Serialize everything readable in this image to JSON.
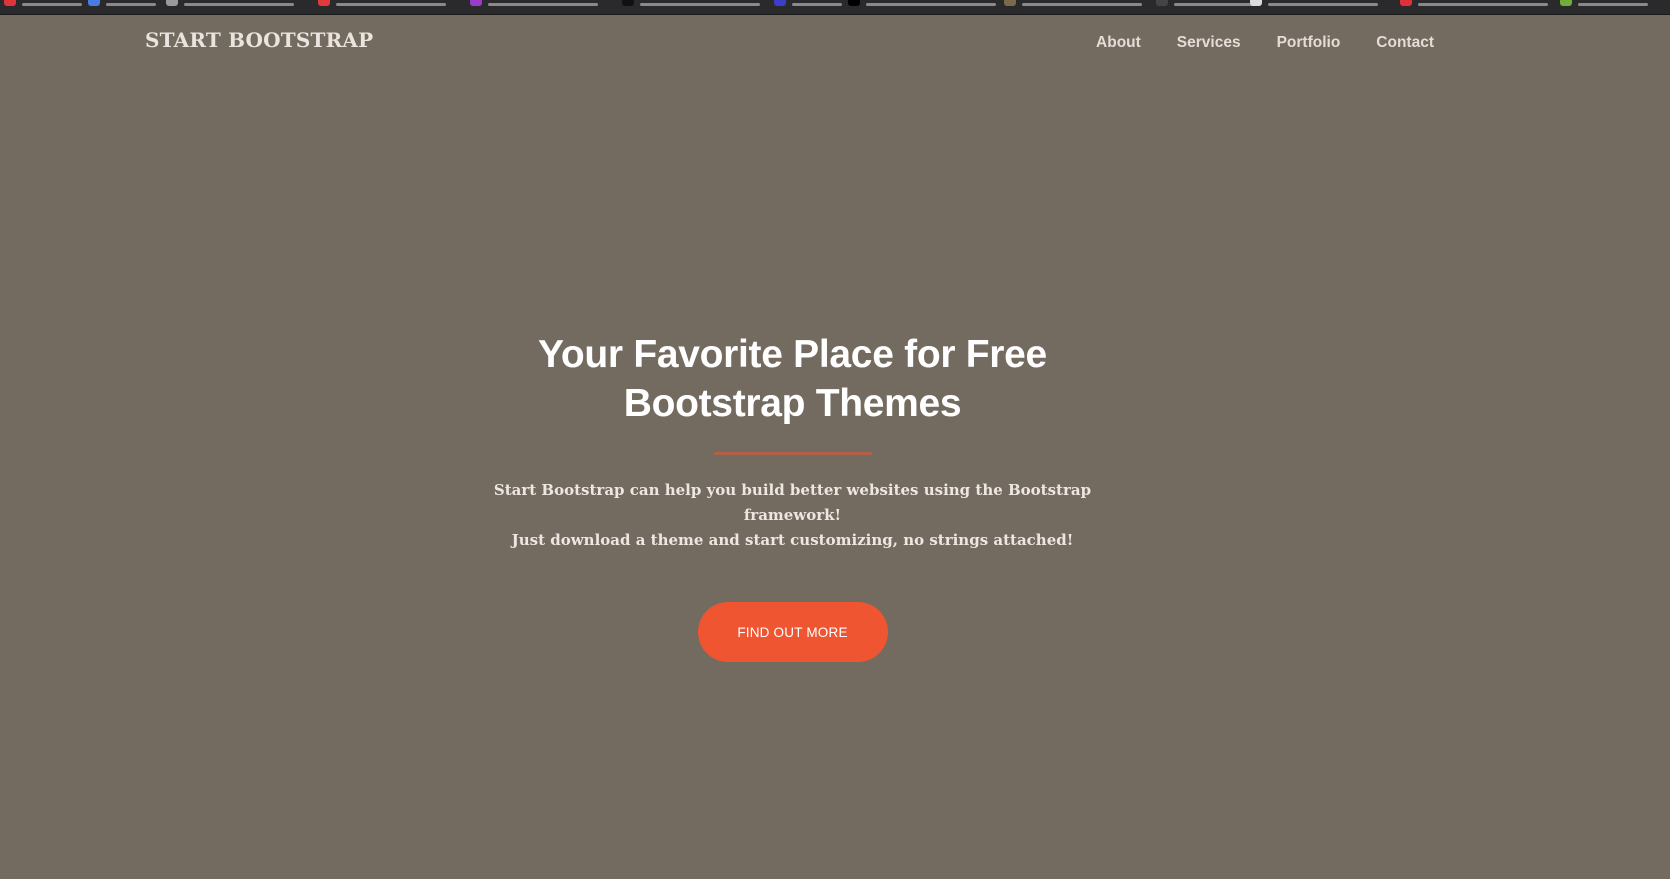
{
  "navbar": {
    "brand": "START BOOTSTRAP",
    "links": [
      "About",
      "Services",
      "Portfolio",
      "Contact"
    ]
  },
  "hero": {
    "title": "Your Favorite Place for Free Bootstrap Themes",
    "text_line1": "Start Bootstrap can help you build better websites using the Bootstrap framework!",
    "text_line2": "Just download a theme and start customizing, no strings attached!",
    "button_label": "FIND OUT MORE"
  },
  "colors": {
    "background": "#736a60",
    "accent": "#f05532",
    "divider": "#b3604a",
    "bookmarks_bar": "#2a2a2c"
  }
}
